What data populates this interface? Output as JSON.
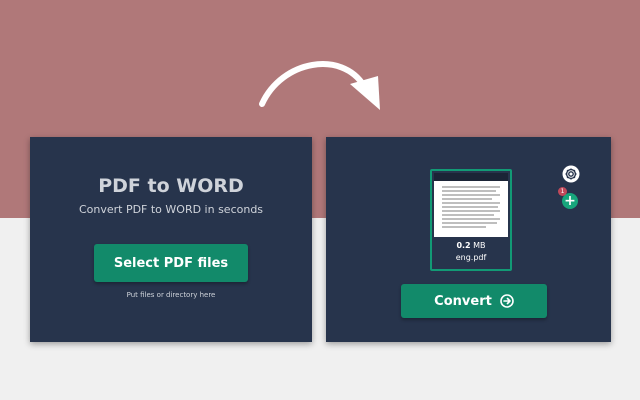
{
  "left_panel": {
    "title": "PDF to WORD",
    "subtitle": "Convert PDF to WORD in seconds",
    "select_button": "Select PDF files",
    "hint": "Put files or directory here"
  },
  "right_panel": {
    "file": {
      "size_value": "0.2",
      "size_unit": "MB",
      "name": "eng.pdf"
    },
    "badge_count": "1",
    "convert_button": "Convert"
  },
  "icons": {
    "arrow": "curved-arrow-icon",
    "gear": "gear-icon",
    "add": "plus-circle-icon",
    "convert": "arrow-right-circle-icon"
  },
  "colors": {
    "top_background": "#b07879",
    "bottom_background": "#f0f0f0",
    "panel": "#27344c",
    "button": "#128a6a",
    "file_border": "#129a75",
    "badge": "#c0495a"
  }
}
